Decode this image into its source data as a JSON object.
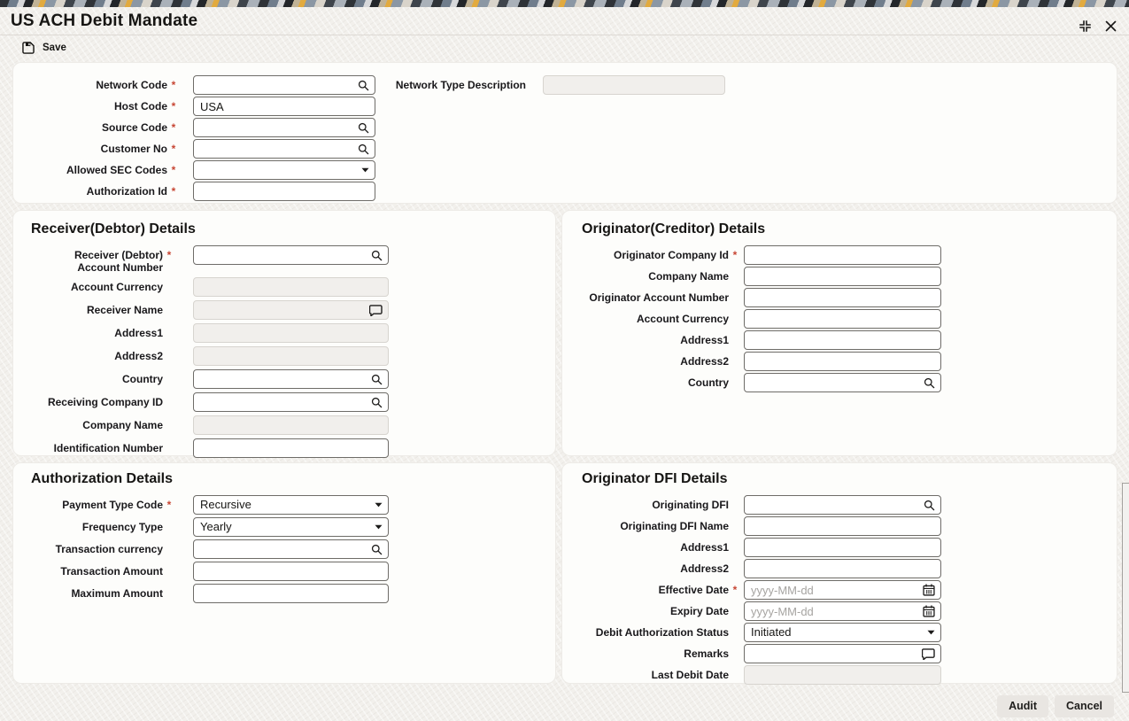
{
  "window": {
    "title": "US ACH Debit Mandate"
  },
  "toolbar": {
    "save": "Save"
  },
  "required_marker": "*",
  "icons": {
    "save": "floppy-disk",
    "search": "magnifying-glass",
    "select": "caret-down",
    "calendar": "calendar",
    "comment": "speech-bubble",
    "resize": "expand-corners",
    "close": "close-x"
  },
  "colors": {
    "required_marker": "#c74634",
    "panel_bg": "#fdfdfb",
    "page_bg": "#f2f0ec",
    "disabled_field_bg": "#f1efec",
    "field_border": "#6e6c68",
    "strip_yellow": "#e2aa3e",
    "strip_charcoal": "#2f3338",
    "strip_slate": "#8b97a4"
  },
  "top_form": {
    "fields": [
      {
        "label": "Network Code",
        "required": true,
        "type": "search",
        "value": ""
      },
      {
        "label": "Host Code",
        "required": true,
        "type": "text",
        "value": "USA"
      },
      {
        "label": "Source Code",
        "required": true,
        "type": "search",
        "value": ""
      },
      {
        "label": "Customer No",
        "required": true,
        "type": "search",
        "value": ""
      },
      {
        "label": "Allowed SEC Codes",
        "required": true,
        "type": "select",
        "value": ""
      },
      {
        "label": "Authorization Id",
        "required": true,
        "type": "text",
        "value": ""
      }
    ],
    "right_fields": [
      {
        "label": "Network Type Description",
        "required": false,
        "type": "disabled",
        "value": ""
      }
    ]
  },
  "receiver": {
    "title": "Receiver(Debtor) Details",
    "fields": [
      {
        "label": "Receiver (Debtor) Account Number",
        "required": true,
        "type": "search",
        "value": ""
      },
      {
        "label": "Account Currency",
        "type": "disabled",
        "value": ""
      },
      {
        "label": "Receiver Name",
        "type": "disabled-comment",
        "value": ""
      },
      {
        "label": "Address1",
        "type": "disabled",
        "value": ""
      },
      {
        "label": "Address2",
        "type": "disabled",
        "value": ""
      },
      {
        "label": "Country",
        "type": "search",
        "value": ""
      },
      {
        "label": "Receiving Company ID",
        "type": "search",
        "value": ""
      },
      {
        "label": "Company Name",
        "type": "disabled",
        "value": ""
      },
      {
        "label": "Identification Number",
        "type": "text",
        "value": ""
      }
    ]
  },
  "originator": {
    "title": "Originator(Creditor) Details",
    "fields": [
      {
        "label": "Originator Company Id",
        "required": true,
        "type": "text",
        "value": ""
      },
      {
        "label": "Company Name",
        "type": "text",
        "value": ""
      },
      {
        "label": "Originator Account Number",
        "type": "text",
        "value": ""
      },
      {
        "label": "Account Currency",
        "type": "text",
        "value": ""
      },
      {
        "label": "Address1",
        "type": "text",
        "value": ""
      },
      {
        "label": "Address2",
        "type": "text",
        "value": ""
      },
      {
        "label": "Country",
        "type": "search",
        "value": ""
      }
    ]
  },
  "authorization": {
    "title": "Authorization Details",
    "fields": [
      {
        "label": "Payment Type Code",
        "required": true,
        "type": "select",
        "value": "Recursive"
      },
      {
        "label": "Frequency Type",
        "type": "select",
        "value": "Yearly"
      },
      {
        "label": "Transaction currency",
        "type": "search",
        "value": ""
      },
      {
        "label": "Transaction Amount",
        "type": "text",
        "value": ""
      },
      {
        "label": "Maximum Amount",
        "type": "text",
        "value": ""
      }
    ]
  },
  "dfi": {
    "title": "Originator DFI Details",
    "fields": [
      {
        "label": "Originating DFI",
        "type": "search",
        "value": ""
      },
      {
        "label": "Originating DFI Name",
        "type": "text",
        "value": ""
      },
      {
        "label": "Address1",
        "type": "text",
        "value": ""
      },
      {
        "label": "Address2",
        "type": "text",
        "value": ""
      },
      {
        "label": "Effective Date",
        "required": true,
        "type": "date",
        "value": "",
        "placeholder": "yyyy-MM-dd"
      },
      {
        "label": "Expiry Date",
        "type": "date",
        "value": "",
        "placeholder": "yyyy-MM-dd"
      },
      {
        "label": "Debit Authorization Status",
        "type": "select",
        "value": "Initiated"
      },
      {
        "label": "Remarks",
        "type": "comment",
        "value": ""
      },
      {
        "label": "Last Debit Date",
        "type": "disabled",
        "value": ""
      }
    ]
  },
  "footer": {
    "audit": "Audit",
    "cancel": "Cancel"
  }
}
